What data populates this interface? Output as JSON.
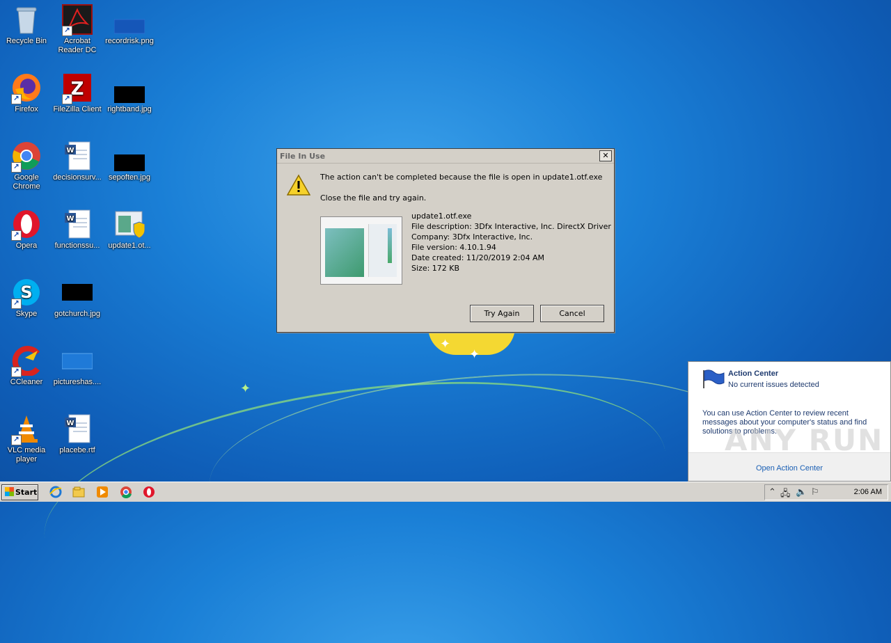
{
  "desktop": {
    "icons": [
      {
        "label": "Recycle Bin"
      },
      {
        "label": "Acrobat Reader DC"
      },
      {
        "label": "recordrisk.png"
      },
      {
        "label": "Firefox"
      },
      {
        "label": "FileZilla Client"
      },
      {
        "label": "rightband.jpg"
      },
      {
        "label": "Google Chrome"
      },
      {
        "label": "decisionsurv..."
      },
      {
        "label": "sepoften.jpg"
      },
      {
        "label": "Opera"
      },
      {
        "label": "functionssu..."
      },
      {
        "label": "update1.ot..."
      },
      {
        "label": "Skype"
      },
      {
        "label": "gotchurch.jpg"
      },
      {
        "label": "CCleaner"
      },
      {
        "label": "pictureshas...."
      },
      {
        "label": "VLC media player"
      },
      {
        "label": "placebe.rtf"
      }
    ]
  },
  "dialog": {
    "title": "File In Use",
    "close_glyph": "✕",
    "message": "The action can't be completed because the file is open in update1.otf.exe",
    "instruction": "Close the file and try again.",
    "file_name": "update1.otf.exe",
    "file_description": "File description: 3Dfx Interactive, Inc. DirectX Driver",
    "company": "Company: 3Dfx Interactive, Inc.",
    "file_version": "File version: 4.10.1.94",
    "date_created": "Date created: 11/20/2019 2:04 AM",
    "size": "Size: 172 KB",
    "try_again_label": "Try Again",
    "cancel_label": "Cancel"
  },
  "action_center": {
    "title": "Action Center",
    "subtitle": "No current issues detected",
    "body": "You can use Action Center to review recent messages about your computer's status and find solutions to problems.",
    "link": "Open Action Center",
    "watermark": "ANY RUN"
  },
  "taskbar": {
    "start_label": "Start",
    "clock": "2:06 AM"
  }
}
